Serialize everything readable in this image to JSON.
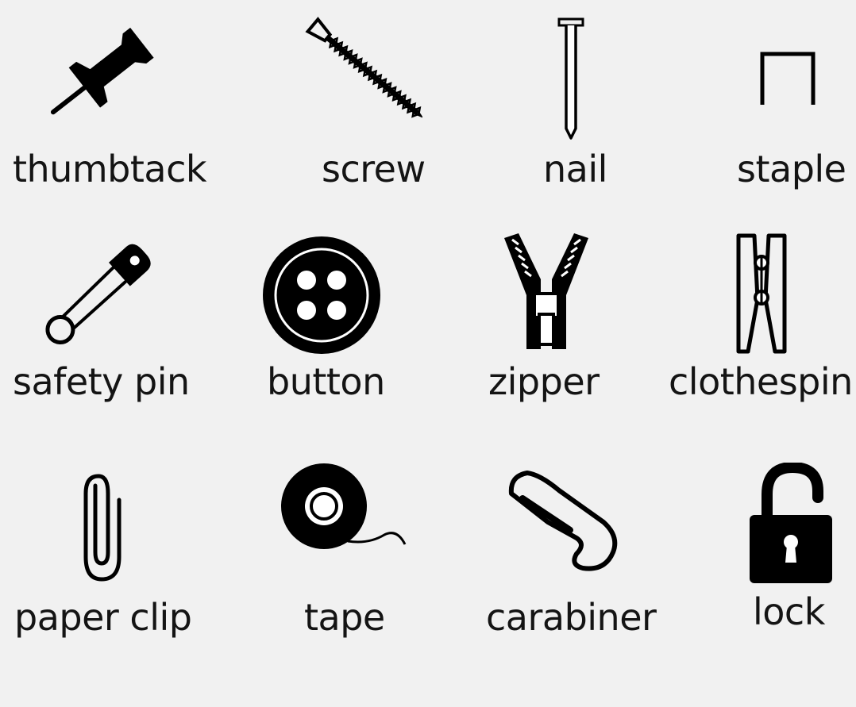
{
  "items": [
    {
      "label": "thumbtack",
      "icon": "thumbtack-icon"
    },
    {
      "label": "screw",
      "icon": "screw-icon"
    },
    {
      "label": "nail",
      "icon": "nail-icon"
    },
    {
      "label": "staple",
      "icon": "staple-icon"
    },
    {
      "label": "safety pin",
      "icon": "safety-pin-icon"
    },
    {
      "label": "button",
      "icon": "button-icon"
    },
    {
      "label": "zipper",
      "icon": "zipper-icon"
    },
    {
      "label": "clothespin",
      "icon": "clothespin-icon"
    },
    {
      "label": "paper clip",
      "icon": "paper-clip-icon"
    },
    {
      "label": "tape",
      "icon": "tape-icon"
    },
    {
      "label": "carabiner",
      "icon": "carabiner-icon"
    },
    {
      "label": "lock",
      "icon": "lock-icon"
    }
  ],
  "colors": {
    "background": "#f1f1f1",
    "ink": "#111111"
  }
}
